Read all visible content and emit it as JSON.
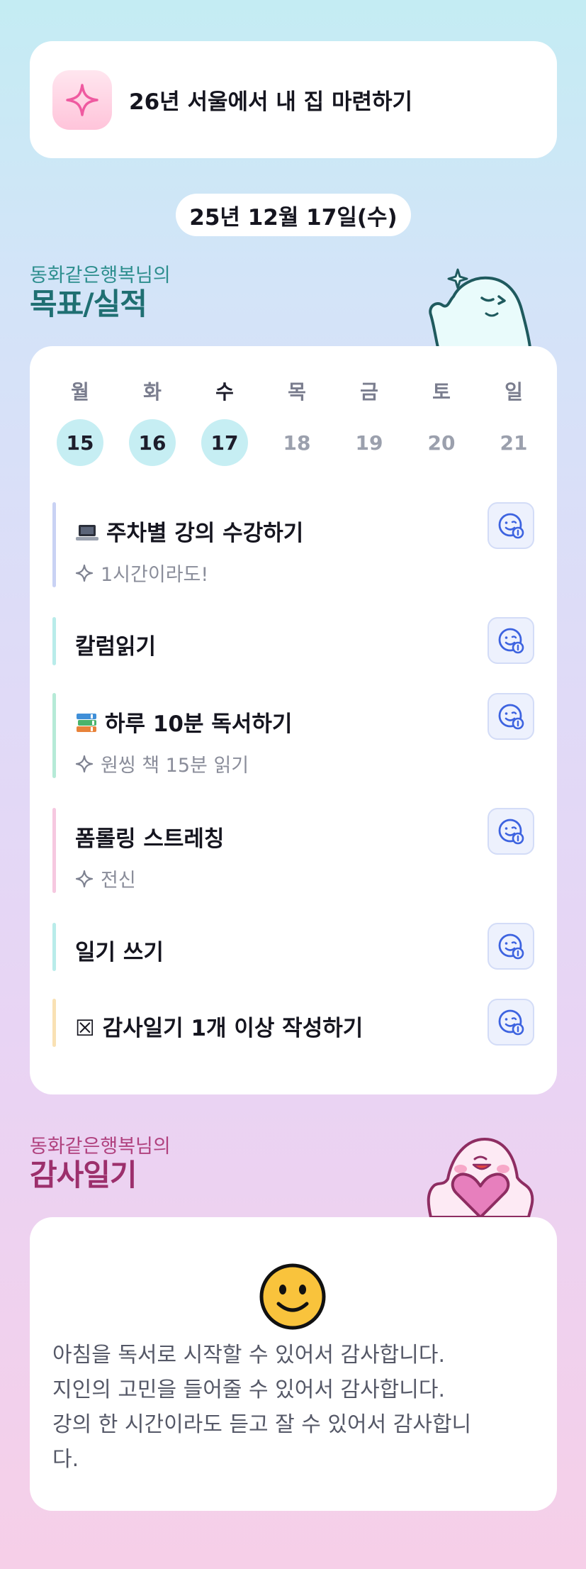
{
  "goal": {
    "title": "26년 서울에서 내 집 마련하기",
    "icon": "sparkle-icon"
  },
  "date": "25년 12월 17일(수)",
  "goals_section": {
    "owner": "동화같은행복님의",
    "title": "목표/실적"
  },
  "week": {
    "days": [
      {
        "name": "월",
        "date": "15",
        "done": true,
        "today": false
      },
      {
        "name": "화",
        "date": "16",
        "done": true,
        "today": false
      },
      {
        "name": "수",
        "date": "17",
        "done": true,
        "today": true
      },
      {
        "name": "목",
        "date": "18",
        "done": false,
        "today": false
      },
      {
        "name": "금",
        "date": "19",
        "done": false,
        "today": false
      },
      {
        "name": "토",
        "date": "20",
        "done": false,
        "today": false
      },
      {
        "name": "일",
        "date": "21",
        "done": false,
        "today": false
      }
    ]
  },
  "tasks": [
    {
      "emoji": "💻",
      "title": "주차별 강의 수강하기",
      "sub": "1시간이라도!",
      "color": "#c9d2f4"
    },
    {
      "emoji": "",
      "title": "칼럼읽기",
      "sub": "",
      "color": "#b9ecea"
    },
    {
      "emoji": "📚",
      "title": "하루 10분 독서하기",
      "sub": "원씽 책 15분 읽기",
      "color": "#b6ead7"
    },
    {
      "emoji": "",
      "title": "폼롤링 스트레칭",
      "sub": "전신",
      "color": "#f6c8e0"
    },
    {
      "emoji": "",
      "title": "일기 쓰기",
      "sub": "",
      "color": "#b9ecea"
    },
    {
      "emoji": "",
      "title": "☒ 감사일기 1개 이상 작성하기",
      "sub": "",
      "color": "#f9e1b4"
    }
  ],
  "gratitude_section": {
    "owner": "동화같은행복님의",
    "title": "감사일기"
  },
  "diary": {
    "mood": "smiley-icon",
    "text": "아침을 독서로 시작할 수 있어서 감사합니다.\n지인의 고민을 들어줄 수 있어서 감사합니다.\n강의 한 시간이라도 듣고 잘 수 있어서 감사합니\n다."
  },
  "colors": {
    "accent_teal": "#1f6f72",
    "accent_pink": "#9c2f6c",
    "done_circle": "#c6eef3",
    "button_blue": "#3d63e0"
  }
}
